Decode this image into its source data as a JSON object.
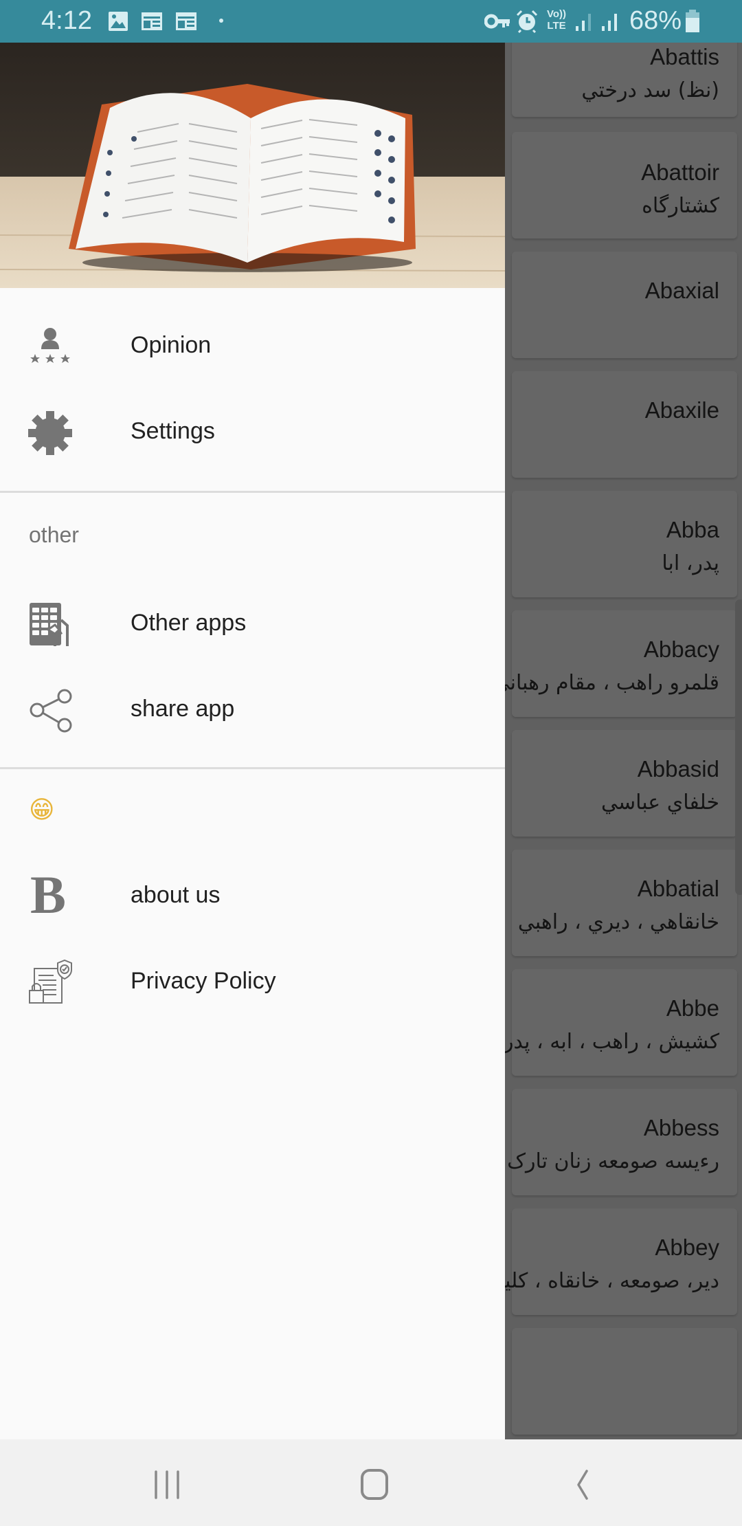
{
  "status_bar": {
    "time": "4:12",
    "battery_percent": "68%",
    "notification_icons": [
      "gallery-icon",
      "news-icon",
      "news-icon",
      "dot-icon"
    ],
    "system_icons": [
      "vpn-key-icon",
      "alarm-icon",
      "volte-lte-icon",
      "signal-icon",
      "signal-icon",
      "battery-icon"
    ],
    "volte_label_top": "Vo))",
    "volte_label_bottom": "LTE",
    "color": "#368a9b"
  },
  "drawer": {
    "header_image": "open-dictionary-book-photo",
    "items_main": [
      {
        "label": "Opinion",
        "icon": "rate-user-icon"
      },
      {
        "label": "Settings",
        "icon": "gear-icon"
      }
    ],
    "section_other": {
      "title": "other",
      "items": [
        {
          "label": "Other apps",
          "icon": "tablet-apps-icon"
        },
        {
          "label": "share app",
          "icon": "share-icon"
        }
      ]
    },
    "section_misc": {
      "title_emoji": "😁",
      "items": [
        {
          "label": "about us",
          "icon": "b-letter-icon",
          "glyph": "B"
        },
        {
          "label": "Privacy Policy",
          "icon": "privacy-policy-icon"
        }
      ]
    }
  },
  "word_list": [
    {
      "en": "Abattis",
      "fa": "(نظ) سد درختي"
    },
    {
      "en": "Abattoir",
      "fa": "کشتارگاه"
    },
    {
      "en": "Abaxial",
      "fa": ""
    },
    {
      "en": "Abaxile",
      "fa": ""
    },
    {
      "en": "Abba",
      "fa": "پدر، ابا"
    },
    {
      "en": "Abbacy",
      "fa": "قلمرو راهب ، مقام رهباني"
    },
    {
      "en": "Abbasid",
      "fa": "خلفاي عباسي"
    },
    {
      "en": "Abbatial",
      "fa": "خانقاهي ، ديري ، راهبي"
    },
    {
      "en": "Abbe",
      "fa": "کشيش ، راهب ، ابه ، پدر"
    },
    {
      "en": "Abbess",
      "fa": "رءيسه صومعه زنان تارک دنيا"
    },
    {
      "en": "Abbey",
      "fa": "دير، صومعه ، خانقاه ، کليسا"
    }
  ],
  "nav_bar": {
    "buttons": [
      "recent-apps",
      "home",
      "back"
    ]
  }
}
